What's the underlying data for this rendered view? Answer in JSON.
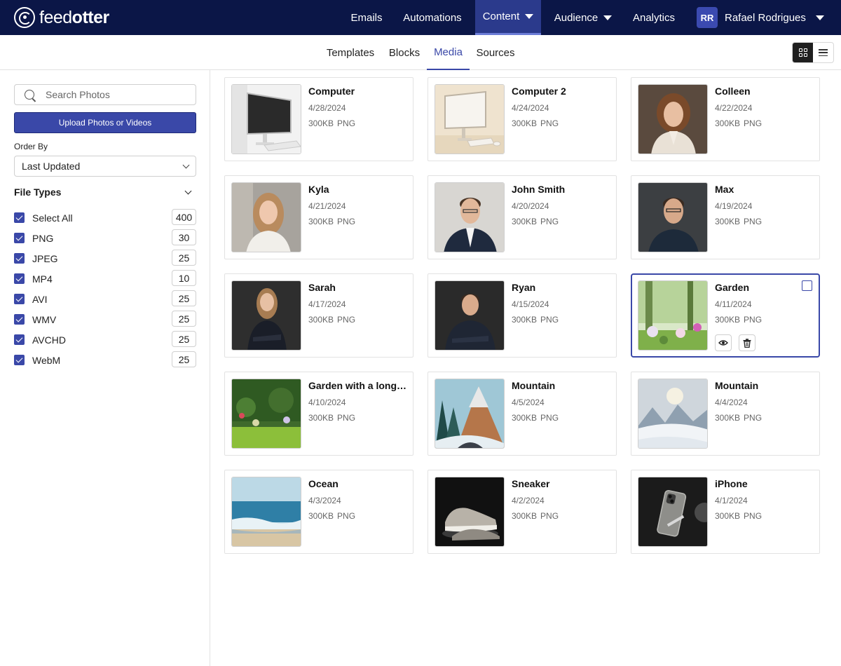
{
  "header": {
    "logo_text_light": "feed",
    "logo_text_bold": "otter",
    "nav": [
      "Emails",
      "Automations",
      "Content",
      "Audience",
      "Analytics"
    ],
    "user_initials": "RR",
    "user_name": "Rafael Rodrigues"
  },
  "subnav": {
    "tabs": [
      "Templates",
      "Blocks",
      "Media",
      "Sources"
    ],
    "active_tab": "Media"
  },
  "sidebar": {
    "search_placeholder": "Search Photos",
    "upload_label": "Upload Photos or Videos",
    "order_by_label": "Order By",
    "order_by_value": "Last Updated",
    "file_types_title": "File Types",
    "file_types": [
      {
        "label": "Select All",
        "count": "400"
      },
      {
        "label": "PNG",
        "count": "30"
      },
      {
        "label": "JPEG",
        "count": "25"
      },
      {
        "label": "MP4",
        "count": "10"
      },
      {
        "label": "AVI",
        "count": "25"
      },
      {
        "label": "WMV",
        "count": "25"
      },
      {
        "label": "AVCHD",
        "count": "25"
      },
      {
        "label": "WebM",
        "count": "25"
      }
    ]
  },
  "media": [
    {
      "title": "Computer",
      "date": "4/28/2024",
      "size": "300KB",
      "type": "PNG"
    },
    {
      "title": "Computer 2",
      "date": "4/24/2024",
      "size": "300KB",
      "type": "PNG"
    },
    {
      "title": "Colleen",
      "date": "4/22/2024",
      "size": "300KB",
      "type": "PNG"
    },
    {
      "title": "Kyla",
      "date": "4/21/2024",
      "size": "300KB",
      "type": "PNG"
    },
    {
      "title": "John Smith",
      "date": "4/20/2024",
      "size": "300KB",
      "type": "PNG"
    },
    {
      "title": "Max",
      "date": "4/19/2024",
      "size": "300KB",
      "type": "PNG"
    },
    {
      "title": "Sarah",
      "date": "4/17/2024",
      "size": "300KB",
      "type": "PNG"
    },
    {
      "title": "Ryan",
      "date": "4/15/2024",
      "size": "300KB",
      "type": "PNG"
    },
    {
      "title": "Garden",
      "date": "4/11/2024",
      "size": "300KB",
      "type": "PNG"
    },
    {
      "title": "Garden with a long name",
      "date": "4/10/2024",
      "size": "300KB",
      "type": "PNG"
    },
    {
      "title": "Mountain",
      "date": "4/5/2024",
      "size": "300KB",
      "type": "PNG"
    },
    {
      "title": "Mountain",
      "date": "4/4/2024",
      "size": "300KB",
      "type": "PNG"
    },
    {
      "title": "Ocean",
      "date": "4/3/2024",
      "size": "300KB",
      "type": "PNG"
    },
    {
      "title": "Sneaker",
      "date": "4/2/2024",
      "size": "300KB",
      "type": "PNG"
    },
    {
      "title": "iPhone",
      "date": "4/1/2024",
      "size": "300KB",
      "type": "PNG"
    }
  ],
  "colors": {
    "topbar": "#0b1647",
    "accent": "#3a48a8"
  }
}
